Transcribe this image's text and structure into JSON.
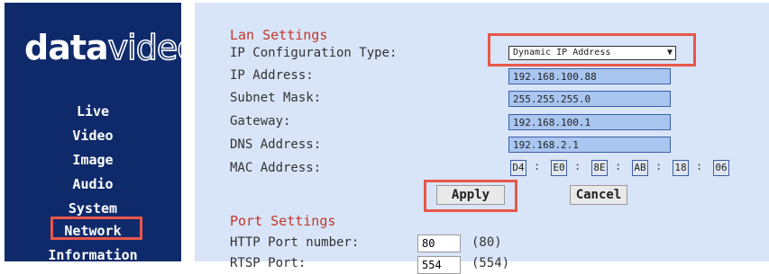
{
  "brand": {
    "logo_bold": "data",
    "logo_outline": "video"
  },
  "sidebar": {
    "items": [
      {
        "label": "Live"
      },
      {
        "label": "Video"
      },
      {
        "label": "Image"
      },
      {
        "label": "Audio"
      },
      {
        "label": "System"
      },
      {
        "label": "Network"
      },
      {
        "label": "Information"
      }
    ],
    "active": "Network"
  },
  "lan": {
    "title": "Lan Settings",
    "ip_config_label": "IP Configuration Type:",
    "ip_config_value": "Dynamic IP Address",
    "ip_label": "IP Address:",
    "ip_value": "192.168.100.88",
    "subnet_label": "Subnet Mask:",
    "subnet_value": "255.255.255.0",
    "gateway_label": "Gateway:",
    "gateway_value": "192.168.100.1",
    "dns_label": "DNS Address:",
    "dns_value": "192.168.2.1",
    "mac_label": "MAC Address:",
    "mac": [
      "D4",
      "E0",
      "8E",
      "AB",
      "18",
      "06"
    ],
    "mac_sep": ":"
  },
  "actions": {
    "apply": "Apply",
    "cancel": "Cancel"
  },
  "ports": {
    "title": "Port Settings",
    "http_label": "HTTP Port number:",
    "http_value": "80",
    "http_default": "(80)",
    "rtsp_label": "RTSP Port:",
    "rtsp_value": "554",
    "rtsp_default": "(554)"
  },
  "colors": {
    "sidebar": "#0f2a6b",
    "main_bg": "#d8e4f8",
    "highlight": "#e8574a",
    "section_title": "#c0392b",
    "field_bg": "#a9c6f0"
  }
}
